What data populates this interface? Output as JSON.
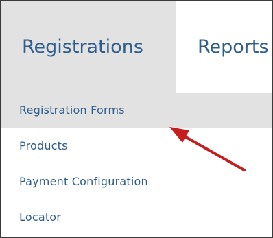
{
  "nav": {
    "tabs": [
      {
        "label": "Registrations"
      },
      {
        "label": "Reports"
      }
    ]
  },
  "menu": {
    "items": [
      {
        "label": "Registration Forms"
      },
      {
        "label": "Products"
      },
      {
        "label": "Payment Configuration"
      },
      {
        "label": "Locator"
      }
    ]
  },
  "annotation": {
    "arrow_color": "#c41e1e",
    "icon": "arrow-icon"
  },
  "colors": {
    "link": "#2f5d8c",
    "active_bg": "#e2e2e2"
  }
}
